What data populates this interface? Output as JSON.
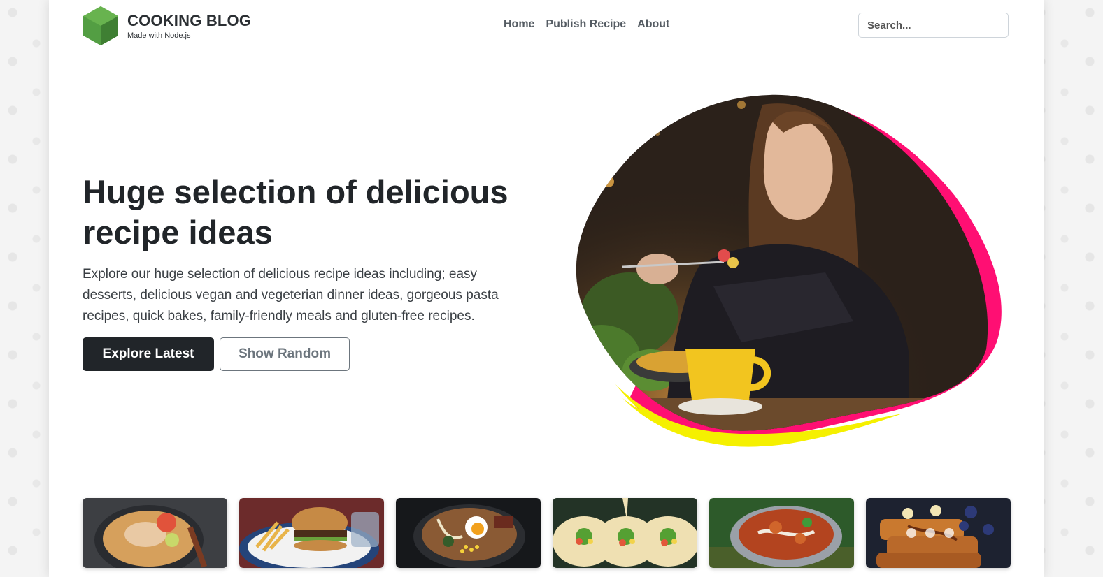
{
  "brand": {
    "title": "COOKING BLOG",
    "subtitle": "Made with Node.js",
    "logo_color": "#539e43"
  },
  "nav": {
    "items": [
      {
        "label": "Home"
      },
      {
        "label": "Publish Recipe"
      },
      {
        "label": "About"
      }
    ]
  },
  "search": {
    "placeholder": "Search..."
  },
  "hero": {
    "title": "Huge selection of delicious recipe ideas",
    "description": "Explore our huge selection of delicious recipe ideas including; easy desserts, delicious vegan and vegeterian dinner ideas, gorgeous pasta recipes, quick bakes, family-friendly meals and gluten-free recipes.",
    "explore_label": "Explore Latest",
    "random_label": "Show Random",
    "image_icon": "woman-eating-photo",
    "accent_colors": [
      "#ff0f73",
      "#f5f000"
    ]
  },
  "thumbnails": [
    {
      "icon": "noodle-soup-photo"
    },
    {
      "icon": "burger-fries-photo"
    },
    {
      "icon": "ramen-egg-photo"
    },
    {
      "icon": "tacos-photo"
    },
    {
      "icon": "curry-bowl-photo"
    },
    {
      "icon": "french-toast-photo"
    }
  ]
}
